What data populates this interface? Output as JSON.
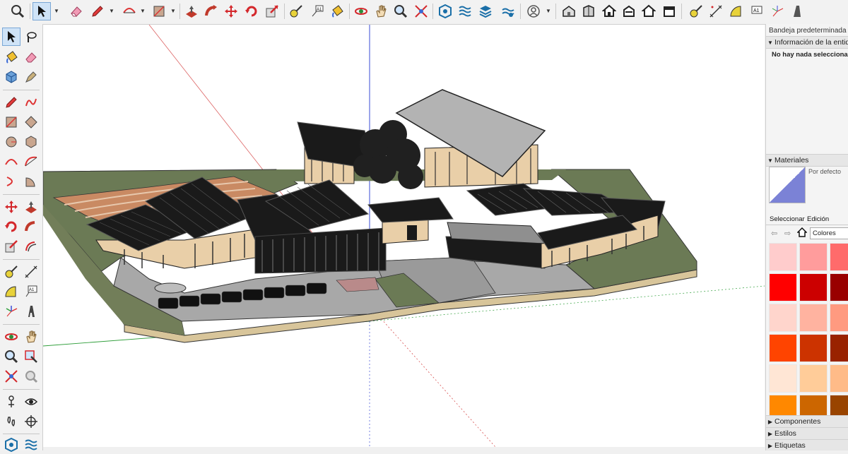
{
  "toolbar": {
    "icons": [
      "magnifier-search-icon",
      "select-arrow-icon",
      "eraser-icon",
      "pencil-line-icon",
      "arc-icon",
      "rectangle-icon",
      "push-pull-icon",
      "follow-me-icon",
      "move-icon",
      "rotate-icon",
      "scale-icon",
      "tape-measure-icon",
      "text-label-icon",
      "paint-bucket-icon",
      "orbit-icon",
      "pan-hand-icon",
      "zoom-icon",
      "zoom-extents-icon",
      "warehouse-icon",
      "sandbox-icon",
      "layers-icon",
      "solar-icon",
      "account-icon",
      "iso-view-icon",
      "front-view-icon",
      "home-view-icon",
      "right-view-icon",
      "back-view-icon",
      "left-view-icon",
      "tape-icon",
      "dimension-icon",
      "protractor-icon",
      "text-icon",
      "axes-icon",
      "section-plane-icon"
    ]
  },
  "tray": {
    "title": "Bandeja predeterminada",
    "entity_info": {
      "header": "Información de la entidad",
      "empty_text": "No hay nada seleccionado"
    },
    "materials": {
      "header": "Materiales",
      "default_label": "Por defecto",
      "tab_select": "Seleccionar",
      "tab_edit": "Edición",
      "library_value": "Colores",
      "swatches": [
        "#ffcccc",
        "#ff9c9c",
        "#ff6b6b",
        "#ff0000",
        "#cc0000",
        "#990000",
        "#ffd5cc",
        "#ffb3a0",
        "#ff9a80",
        "#ff4400",
        "#cc3300",
        "#992200",
        "#ffe6d5",
        "#ffcc99",
        "#ffbb88",
        "#ff8800",
        "#cc6600",
        "#994400"
      ]
    },
    "components": {
      "header": "Componentes"
    },
    "styles": {
      "header": "Estilos"
    },
    "tags": {
      "header": "Etiquetas"
    }
  },
  "colors": {
    "axis_red": "#d33a3a",
    "axis_green": "#2f9e3a",
    "axis_blue": "#3a4bd6",
    "roof_dark": "#1a1a1a",
    "roof_gray": "#b3b3b3",
    "wall": "#e9cfa8",
    "ground_green": "#6b7a55",
    "paving": "#a8a8a8",
    "terrace": "#c98a63"
  }
}
